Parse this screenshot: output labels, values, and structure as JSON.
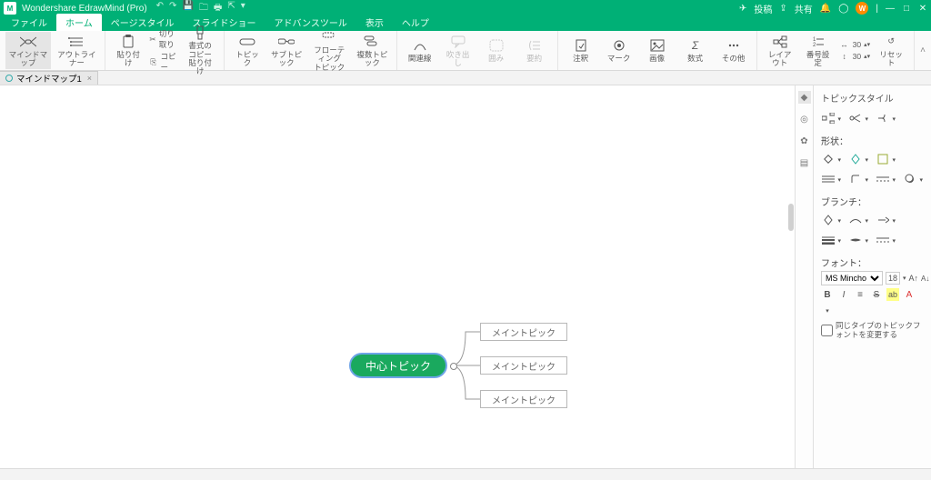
{
  "app": {
    "title": "Wondershare EdrawMind (Pro)"
  },
  "titlebar_right": {
    "post": "投稿",
    "share": "共有",
    "avatar": "W"
  },
  "menubar": {
    "items": [
      "ファイル",
      "ホーム",
      "ページスタイル",
      "スライドショー",
      "アドバンスツール",
      "表示",
      "ヘルプ"
    ],
    "active": 1
  },
  "ribbon": {
    "view": {
      "mindmap": "マインドマップ",
      "outliner": "アウトライナー"
    },
    "clipboard": {
      "paste": "貼り付け",
      "cut": "切り取り",
      "copy": "コピー",
      "format_copy": "書式のコピー\n貼り付け"
    },
    "topics": {
      "topic": "トピック",
      "subtopic": "サブトピック",
      "floating": "フローティング\nトピック",
      "multi": "複数トピック"
    },
    "links": {
      "relation": "関連線",
      "callout": "吹き出し",
      "wrap": "囲み",
      "summary": "要約"
    },
    "insert": {
      "note": "注釈",
      "mark": "マーク",
      "image": "画像",
      "formula": "数式",
      "other": "その他"
    },
    "layout": {
      "layout": "レイアウト",
      "numbering": "番号設定",
      "width_val": "30",
      "reset": "リセット"
    }
  },
  "doc": {
    "tab": "マインドマップ1"
  },
  "map": {
    "central": "中心トピック",
    "main": [
      "メイントピック",
      "メイントピック",
      "メイントピック"
    ]
  },
  "panel": {
    "title": "トピックスタイル",
    "shape": "形状：",
    "branch": "ブランチ：",
    "font": "フォント：",
    "font_name": "MS Mincho",
    "font_size": "18",
    "font_note": "同じタイプのトピックフォントを変更する"
  }
}
